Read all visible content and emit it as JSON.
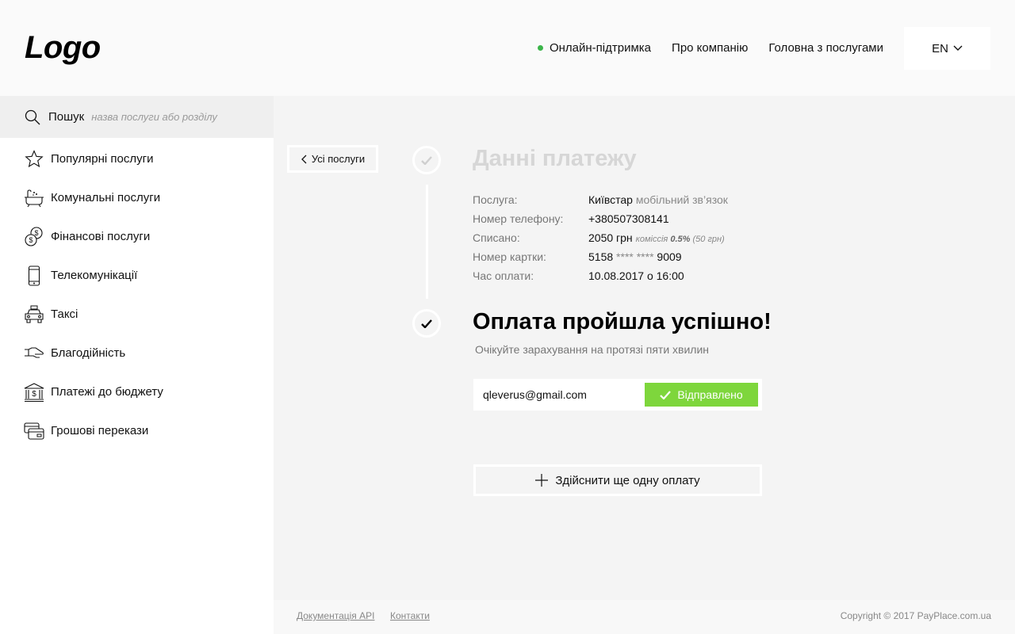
{
  "header": {
    "logo": "Logo",
    "nav": {
      "support": "Онлайн-підтримка",
      "about": "Про компанію",
      "home_services": "Головна з послугами"
    },
    "language": "EN",
    "status_color": "#3cb54a"
  },
  "sidebar": {
    "search_label": "Пошук",
    "search_placeholder": "назва послуги або розділу",
    "items": [
      {
        "label": "Популярні послуги",
        "icon": "star-icon"
      },
      {
        "label": "Комунальні послуги",
        "icon": "bathtub-icon"
      },
      {
        "label": "Фінансові послуги",
        "icon": "coins-icon"
      },
      {
        "label": "Телекомунікації",
        "icon": "phone-icon"
      },
      {
        "label": "Таксі",
        "icon": "taxi-icon"
      },
      {
        "label": "Благодійність",
        "icon": "hand-icon"
      },
      {
        "label": "Платежі до бюджету",
        "icon": "bank-icon"
      },
      {
        "label": "Грошові перекази",
        "icon": "transfer-icon"
      }
    ]
  },
  "main": {
    "back_label": "Усі послуги",
    "section_title": "Данні платежу",
    "details": {
      "service_key": "Послуга:",
      "service_value": "Київстар",
      "service_sub": "мобільний зв’язок",
      "phone_key": "Номер телефону:",
      "phone_value": "+380507308141",
      "charged_key": "Списано:",
      "charged_value": "2050 грн",
      "commission_label": "комісcія",
      "commission_rate": "0.5%",
      "commission_amount": "(50 грн)",
      "card_key": "Номер картки:",
      "card_start": "5158",
      "card_mask": "**** ****",
      "card_end": "9009",
      "time_key": "Час оплати:",
      "time_value": "10.08.2017 о 16:00"
    },
    "success_title": "Оплата пройшла успішно!",
    "success_subtitle": "Очікуйте зарахування на протязі пяти хвилин",
    "email_value": "qleverus@gmail.com",
    "sent_label": "Відправлено",
    "another_payment_label": "Здійснити ще одну оплату",
    "accent_color": "#7ed63c"
  },
  "footer": {
    "api_docs": "Документація API",
    "contacts": "Контакти",
    "copyright": "Copyright © 2017 PayPlace.com.ua"
  }
}
